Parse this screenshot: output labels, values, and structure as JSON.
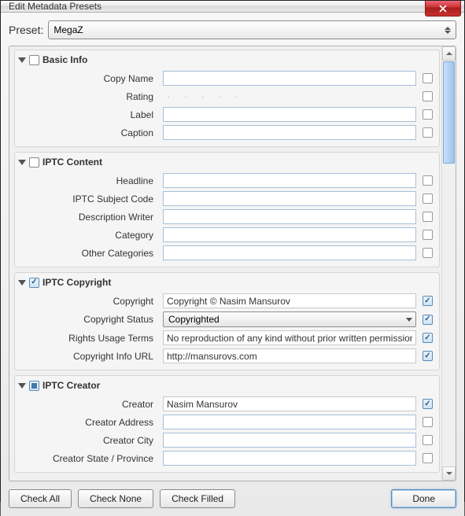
{
  "titlebar": {
    "title": "Edit Metadata Presets"
  },
  "preset": {
    "label": "Preset:",
    "value": "MegaZ"
  },
  "sections": {
    "basic": {
      "title": "Basic Info",
      "check": "none",
      "fields": {
        "copy_name": {
          "label": "Copy Name",
          "value": "",
          "checked": false
        },
        "rating": {
          "label": "Rating",
          "checked": false
        },
        "label": {
          "label": "Label",
          "value": "",
          "checked": false
        },
        "caption": {
          "label": "Caption",
          "value": "",
          "checked": false
        }
      }
    },
    "iptc_content": {
      "title": "IPTC Content",
      "check": "none",
      "fields": {
        "headline": {
          "label": "Headline",
          "value": "",
          "checked": false
        },
        "subject": {
          "label": "IPTC Subject Code",
          "value": "",
          "checked": false
        },
        "descwriter": {
          "label": "Description Writer",
          "value": "",
          "checked": false
        },
        "category": {
          "label": "Category",
          "value": "",
          "checked": false
        },
        "othercat": {
          "label": "Other Categories",
          "value": "",
          "checked": false
        }
      }
    },
    "iptc_copyright": {
      "title": "IPTC Copyright",
      "check": "checked",
      "fields": {
        "copyright": {
          "label": "Copyright",
          "value": "Copyright © Nasim Mansurov",
          "checked": true
        },
        "status": {
          "label": "Copyright Status",
          "value": "Copyrighted",
          "checked": true
        },
        "rights": {
          "label": "Rights Usage Terms",
          "value": "No reproduction of any kind without prior written permission",
          "checked": true
        },
        "infourl": {
          "label": "Copyright Info URL",
          "value": "http://mansurovs.com",
          "checked": true
        }
      }
    },
    "iptc_creator": {
      "title": "IPTC Creator",
      "check": "partial",
      "fields": {
        "creator": {
          "label": "Creator",
          "value": "Nasim Mansurov",
          "checked": true
        },
        "address": {
          "label": "Creator Address",
          "value": "",
          "checked": false
        },
        "city": {
          "label": "Creator City",
          "value": "",
          "checked": false
        },
        "state": {
          "label": "Creator State / Province",
          "value": "",
          "checked": false
        }
      }
    }
  },
  "footer": {
    "check_all": "Check All",
    "check_none": "Check None",
    "check_filled": "Check Filled",
    "done": "Done"
  }
}
